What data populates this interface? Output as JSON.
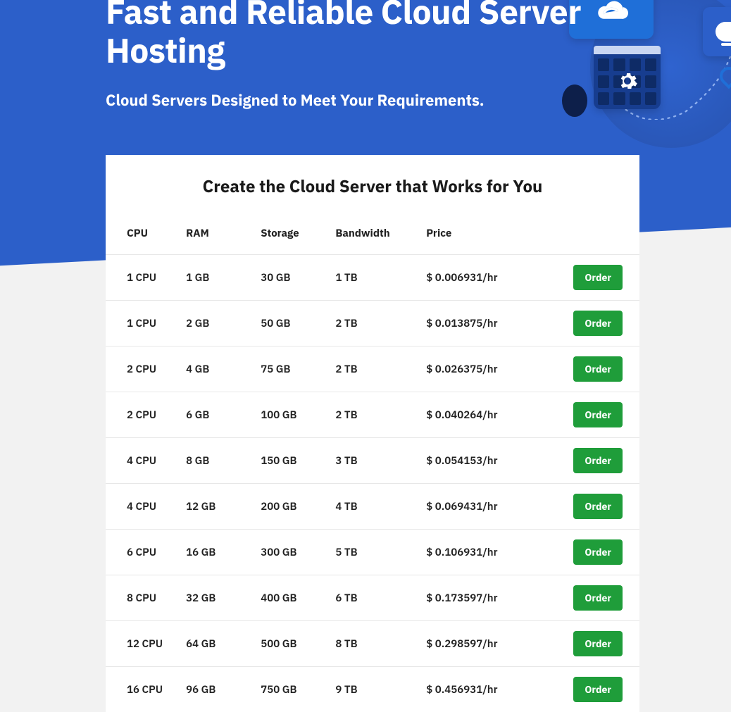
{
  "hero": {
    "title": "Fast and Reliable Cloud Server Hosting",
    "subtitle": "Cloud Servers Designed to Meet Your Requirements."
  },
  "panel": {
    "heading": "Create the Cloud Server that Works for You",
    "order_label": "Order",
    "columns": {
      "cpu": "CPU",
      "ram": "RAM",
      "storage": "Storage",
      "bandwidth": "Bandwidth",
      "price": "Price"
    },
    "rows": [
      {
        "cpu": "1 CPU",
        "ram": "1 GB",
        "storage": "30 GB",
        "bandwidth": "1 TB",
        "price": "$ 0.006931/hr"
      },
      {
        "cpu": "1 CPU",
        "ram": "2 GB",
        "storage": "50 GB",
        "bandwidth": "2 TB",
        "price": "$ 0.013875/hr"
      },
      {
        "cpu": "2 CPU",
        "ram": "4 GB",
        "storage": "75 GB",
        "bandwidth": "2 TB",
        "price": "$ 0.026375/hr"
      },
      {
        "cpu": "2 CPU",
        "ram": "6 GB",
        "storage": "100 GB",
        "bandwidth": "2 TB",
        "price": "$ 0.040264/hr"
      },
      {
        "cpu": "4 CPU",
        "ram": "8 GB",
        "storage": "150 GB",
        "bandwidth": "3 TB",
        "price": "$ 0.054153/hr"
      },
      {
        "cpu": "4 CPU",
        "ram": "12 GB",
        "storage": "200 GB",
        "bandwidth": "4 TB",
        "price": "$ 0.069431/hr"
      },
      {
        "cpu": "6 CPU",
        "ram": "16 GB",
        "storage": "300 GB",
        "bandwidth": "5 TB",
        "price": "$ 0.106931/hr"
      },
      {
        "cpu": "8 CPU",
        "ram": "32 GB",
        "storage": "400 GB",
        "bandwidth": "6 TB",
        "price": "$ 0.173597/hr"
      },
      {
        "cpu": "12 CPU",
        "ram": "64 GB",
        "storage": "500 GB",
        "bandwidth": "8 TB",
        "price": "$ 0.298597/hr"
      },
      {
        "cpu": "16 CPU",
        "ram": "96 GB",
        "storage": "750 GB",
        "bandwidth": "9 TB",
        "price": "$ 0.456931/hr"
      }
    ]
  },
  "colors": {
    "primary": "#2c5fc9",
    "action": "#1f9d3a"
  }
}
